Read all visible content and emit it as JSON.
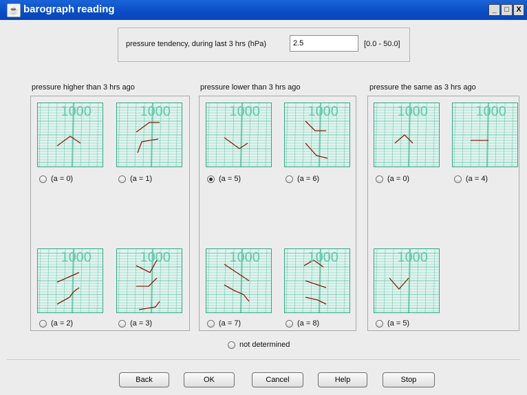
{
  "window": {
    "title": "barograph reading",
    "app_icon": "java-cup-icon",
    "controls": {
      "minimize": "_",
      "maximize": "□",
      "close": "X"
    }
  },
  "tendency": {
    "label": "pressure tendency, during last 3 hrs (hPa)",
    "value": "2.5",
    "range": "[0.0 - 50.0]"
  },
  "groups": [
    {
      "title": "pressure higher than 3 hrs ago",
      "options": [
        {
          "label": "(a = 0)",
          "selected": false
        },
        {
          "label": "(a = 1)",
          "selected": false
        },
        {
          "label": "(a = 2)",
          "selected": false
        },
        {
          "label": "(a = 3)",
          "selected": false
        }
      ]
    },
    {
      "title": "pressure lower than 3 hrs ago",
      "options": [
        {
          "label": "(a = 5)",
          "selected": true
        },
        {
          "label": "(a = 6)",
          "selected": false
        },
        {
          "label": "(a = 7)",
          "selected": false
        },
        {
          "label": "(a = 8)",
          "selected": false
        }
      ]
    },
    {
      "title": "pressure the same as 3 hrs ago",
      "options": [
        {
          "label": "(a = 0)",
          "selected": false
        },
        {
          "label": "(a = 4)",
          "selected": false
        },
        {
          "label": "(a = 5)",
          "selected": false
        }
      ]
    }
  ],
  "chart_scale_label": "1000",
  "not_determined": {
    "label": "not determined",
    "selected": false
  },
  "buttons": {
    "back": "Back",
    "ok": "OK",
    "cancel": "Cancel",
    "help": "Help",
    "stop": "Stop"
  },
  "colors": {
    "titlebar": "#0a4cc4",
    "grid": "#4ab898",
    "trace": "#8b1a0a"
  }
}
